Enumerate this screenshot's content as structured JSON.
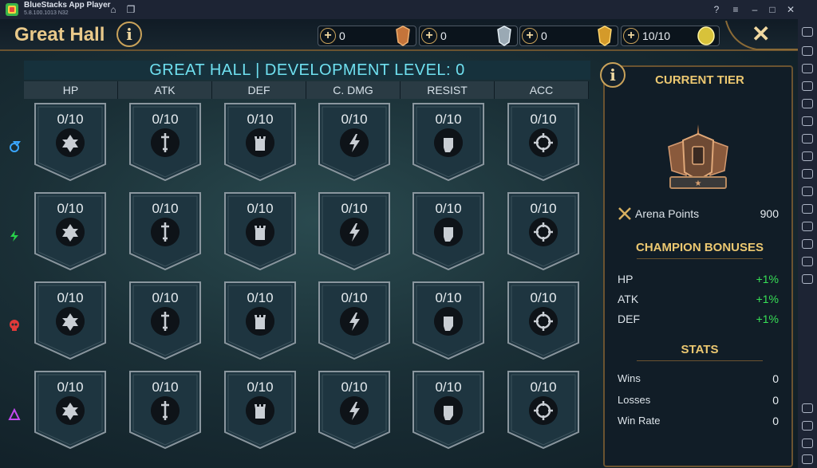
{
  "window": {
    "title": "BlueStacks App Player",
    "version": "5.8.100.1013 N32"
  },
  "header": {
    "title": "Great Hall"
  },
  "resources": [
    {
      "value": "0",
      "icon": "bronze-medal-icon"
    },
    {
      "value": "0",
      "icon": "silver-medal-icon"
    },
    {
      "value": "0",
      "icon": "gold-medal-icon"
    },
    {
      "value": "10/10",
      "icon": "arena-token-icon"
    }
  ],
  "grid": {
    "heading": "GREAT HALL | DEVELOPMENT LEVEL: 0",
    "columns": [
      "HP",
      "ATK",
      "DEF",
      "C. DMG",
      "RESIST",
      "ACC"
    ],
    "rows": [
      {
        "affinity": "magic",
        "color": "#3aa6ff",
        "values": [
          "0/10",
          "0/10",
          "0/10",
          "0/10",
          "0/10",
          "0/10"
        ]
      },
      {
        "affinity": "spirit",
        "color": "#28d24a",
        "values": [
          "0/10",
          "0/10",
          "0/10",
          "0/10",
          "0/10",
          "0/10"
        ]
      },
      {
        "affinity": "force",
        "color": "#e03a3a",
        "values": [
          "0/10",
          "0/10",
          "0/10",
          "0/10",
          "0/10",
          "0/10"
        ]
      },
      {
        "affinity": "void",
        "color": "#c44af0",
        "values": [
          "0/10",
          "0/10",
          "0/10",
          "0/10",
          "0/10",
          "0/10"
        ]
      }
    ]
  },
  "panel": {
    "tier_title": "CURRENT TIER",
    "arena_points_label": "Arena Points",
    "arena_points_value": "900",
    "bonuses_title": "CHAMPION BONUSES",
    "bonuses": [
      {
        "label": "HP",
        "value": "+1%"
      },
      {
        "label": "ATK",
        "value": "+1%"
      },
      {
        "label": "DEF",
        "value": "+1%"
      }
    ],
    "stats_title": "STATS",
    "stats": [
      {
        "label": "Wins",
        "value": "0"
      },
      {
        "label": "Losses",
        "value": "0"
      },
      {
        "label": "Win Rate",
        "value": "0"
      }
    ]
  },
  "colors": {
    "gold": "#ecc871",
    "cyan": "#6fe0f0",
    "green": "#37e056"
  }
}
